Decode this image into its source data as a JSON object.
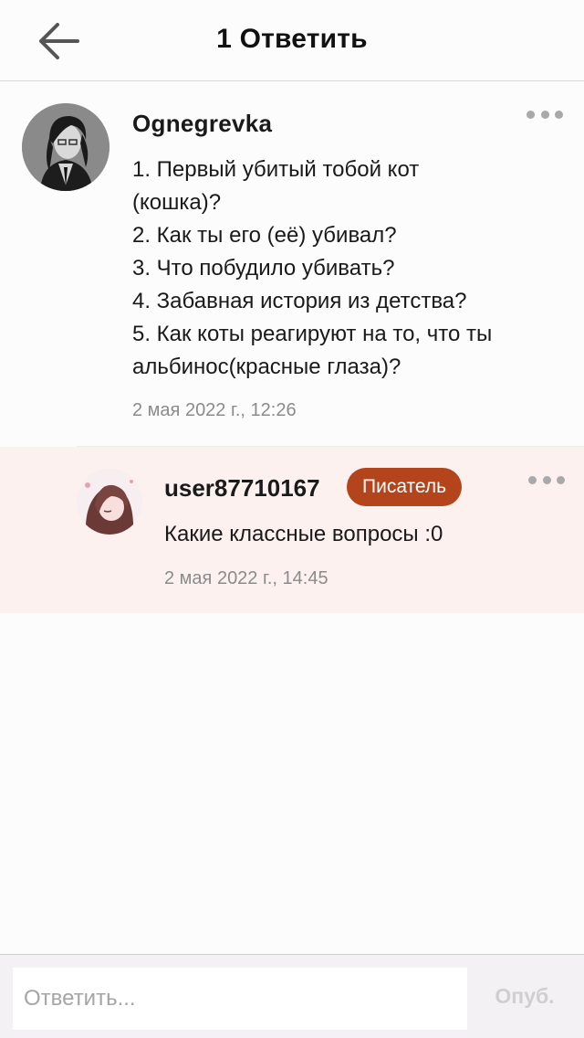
{
  "header": {
    "title": "1 Ответить",
    "back_icon": "arrow-left-icon"
  },
  "comment": {
    "author": "Ognegrevka",
    "lines": [
      "1. Первый убитый тобой кот",
      "(кошка)?",
      "2. Как ты его (её) убивал?",
      "3. Что побудило убивать?",
      "4. Забавная история из детства?",
      "5. Как коты реагируют на то, что ты",
      "альбинос(красные глаза)?"
    ],
    "timestamp": "2 мая 2022 г., 12:26",
    "more_icon": "more-dots-icon"
  },
  "reply": {
    "author": "user87710167",
    "badge": "Писатель",
    "text": "Какие классные вопросы :0",
    "timestamp": "2 мая 2022 г., 14:45",
    "more_icon": "more-dots-icon"
  },
  "footer": {
    "placeholder": "Ответить...",
    "publish_label": "Опуб."
  },
  "colors": {
    "badge_bg": "#b4441c",
    "reply_bg": "#fdf1ef",
    "publish_disabled": "#cfcfcf"
  }
}
